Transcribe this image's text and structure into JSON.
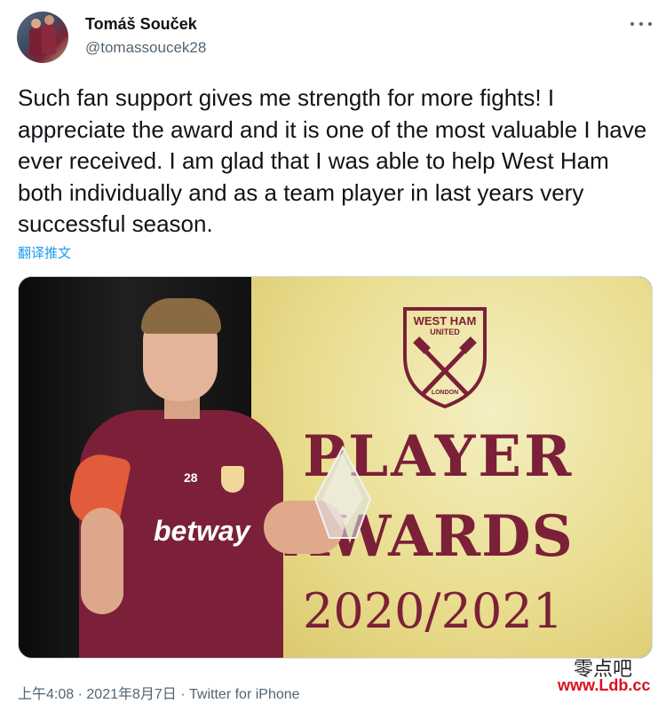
{
  "author": {
    "display_name": "Tomáš Souček",
    "handle": "@tomassoucek28"
  },
  "tweet": {
    "text": "Such fan support gives me strength for more fights! I appreciate the award and it is one of the most valuable I have ever received. I am glad that I was able to help West Ham both individually and as a team player in last years very successful season.",
    "translate_label": "翻译推文"
  },
  "image": {
    "crest_name": "WEST HAM",
    "crest_sub": "UNITED",
    "crest_city": "LONDON",
    "backdrop_line1": "PLAYER",
    "backdrop_line2": "AWARDS",
    "backdrop_line3": "2020/2021",
    "shirt_number": "28",
    "shirt_sponsor": "betway"
  },
  "meta": {
    "time": "上午4:08",
    "date": "2021年8月7日",
    "separator": "·",
    "app": "Twitter for iPhone"
  },
  "watermark": {
    "line1": "零点吧",
    "line2": "www.Ldb.cc"
  },
  "colors": {
    "link": "#1d9bf0",
    "secondary_text": "#536471",
    "claret": "#7b2038"
  },
  "icons": {
    "more": "more-horizontal-icon"
  }
}
